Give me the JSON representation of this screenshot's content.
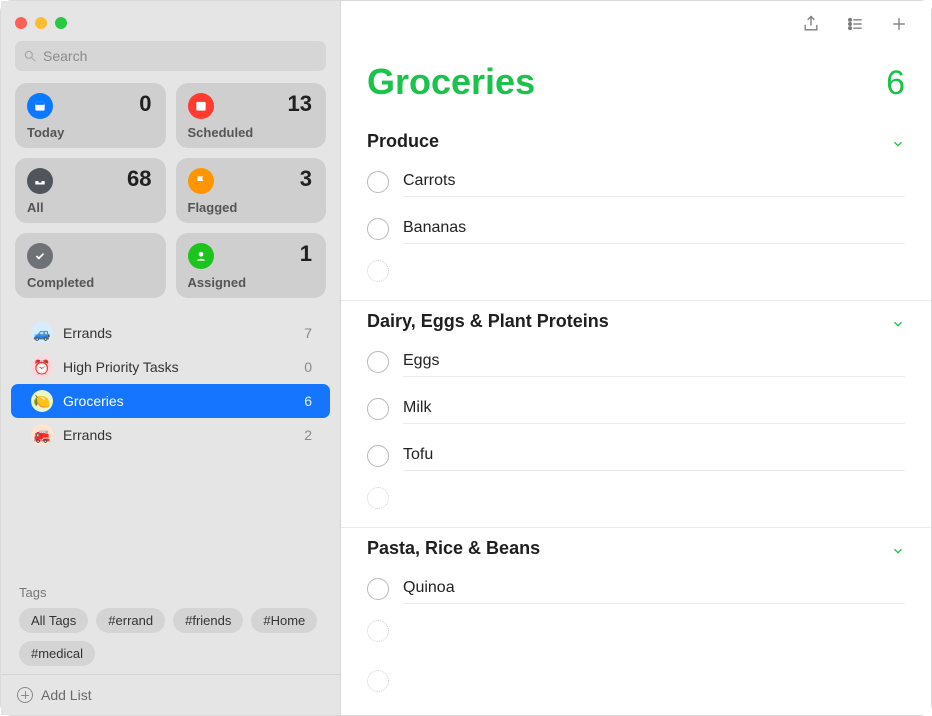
{
  "search": {
    "placeholder": "Search"
  },
  "smartLists": {
    "today": {
      "label": "Today",
      "count": 0,
      "color": "#0b79ff"
    },
    "scheduled": {
      "label": "Scheduled",
      "count": 13,
      "color": "#ff3b30"
    },
    "all": {
      "label": "All",
      "count": 68,
      "color": "#50555c"
    },
    "flagged": {
      "label": "Flagged",
      "count": 3,
      "color": "#ff9500"
    },
    "completed": {
      "label": "Completed",
      "count": "",
      "color": "#6e7176"
    },
    "assigned": {
      "label": "Assigned",
      "count": 1,
      "color": "#1ec41e"
    }
  },
  "lists": [
    {
      "name": "Errands",
      "count": 7,
      "emoji": "🚙",
      "bg": "#d6ecff"
    },
    {
      "name": "High Priority Tasks",
      "count": 0,
      "emoji": "⏰",
      "bg": "#ffd6dc"
    },
    {
      "name": "Groceries",
      "count": 6,
      "emoji": "🍋",
      "bg": "#eaf7c8",
      "selected": true
    },
    {
      "name": "Errands",
      "count": 2,
      "emoji": "🚒",
      "bg": "#ffe4cf"
    }
  ],
  "tagsHeader": "Tags",
  "tags": [
    "All Tags",
    "#errand",
    "#friends",
    "#Home",
    "#medical"
  ],
  "addList": "Add List",
  "main": {
    "title": "Groceries",
    "count": 6,
    "accent": "#1bc24b",
    "sections": [
      {
        "title": "Produce",
        "items": [
          "Carrots",
          "Bananas"
        ]
      },
      {
        "title": "Dairy, Eggs & Plant Proteins",
        "items": [
          "Eggs",
          "Milk",
          "Tofu"
        ]
      },
      {
        "title": "Pasta, Rice & Beans",
        "items": [
          "Quinoa"
        ]
      }
    ]
  }
}
